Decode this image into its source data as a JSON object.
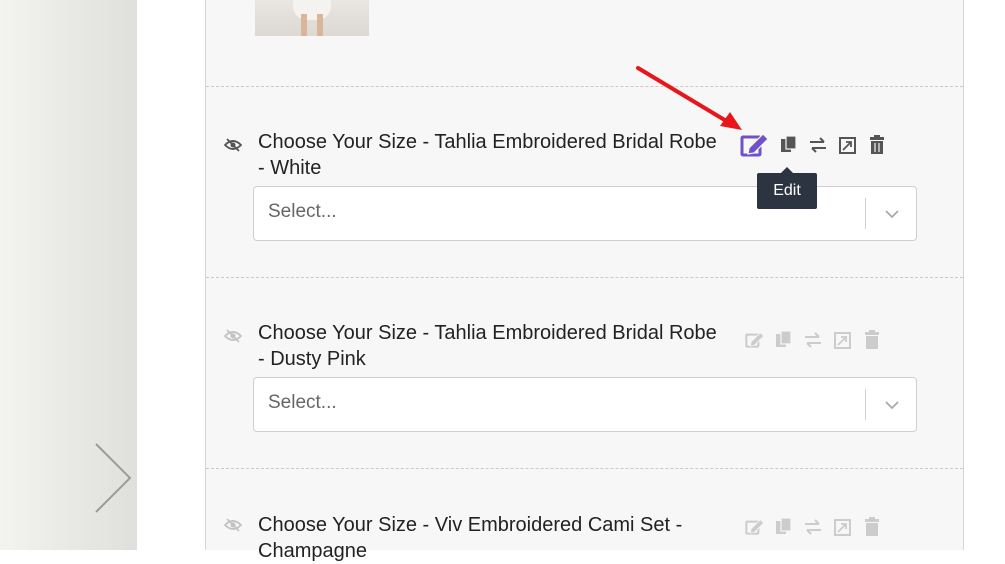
{
  "colors": {
    "accent": "#6f52c9",
    "arrow": "#e8161b",
    "tooltip_bg": "#2b3440",
    "icon_muted": "#c9c9c9",
    "icon_dark": "#555555"
  },
  "options": [
    {
      "title": "Choose Your Size - Tahlia Embroidered Bridal Robe - White",
      "select_placeholder": "Select...",
      "active": true
    },
    {
      "title": "Choose Your Size - Tahlia Embroidered Bridal Robe - Dusty Pink",
      "select_placeholder": "Select...",
      "active": false
    },
    {
      "title": "Choose Your Size - Viv Embroidered Cami Set - Champagne",
      "active": false
    }
  ],
  "toolbar_icons": [
    "edit-icon",
    "duplicate-icon",
    "swap-icon",
    "resize-icon",
    "trash-icon"
  ],
  "tooltip": {
    "text": "Edit"
  }
}
